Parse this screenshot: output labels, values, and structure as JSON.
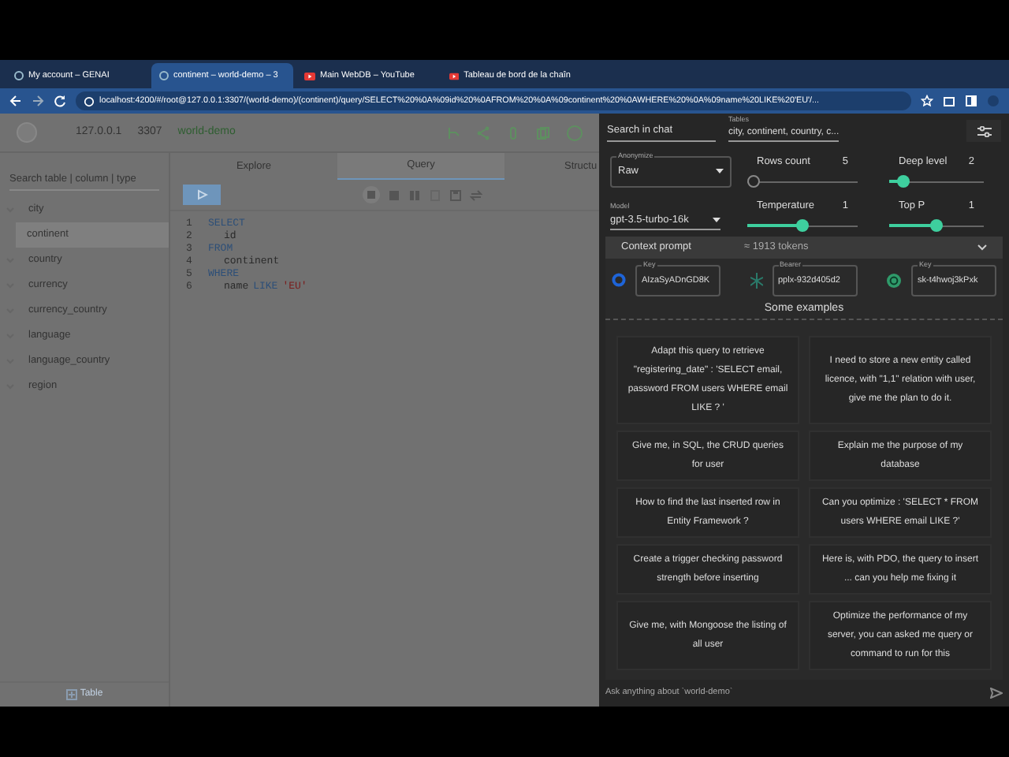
{
  "browser": {
    "tabs": [
      {
        "label": "My account – GENAI",
        "selected": false,
        "kind": "site"
      },
      {
        "label": "continent – world-demo – 3",
        "selected": true,
        "kind": "site"
      },
      {
        "label": "Main WebDB – YouTube",
        "selected": false,
        "kind": "video"
      },
      {
        "label": "Tableau de bord de la chaîn",
        "selected": false,
        "kind": "video"
      }
    ],
    "url": "localhost:4200/#/root@127.0.0.1:3307/(world-demo)/(continent)/query/SELECT%20%0A%09id%20%0AFROM%20%0A%09continent%20%0AWHERE%20%0A%09name%20LIKE%20'EU'/..."
  },
  "app": {
    "host": "127.0.0.1",
    "port": "3307",
    "database": "world-demo"
  },
  "sidebar": {
    "search": {
      "placeholder": "Search table | column | type"
    },
    "items": [
      {
        "label": "city",
        "selected": false
      },
      {
        "label": "continent",
        "selected": true
      },
      {
        "label": "country",
        "selected": false
      },
      {
        "label": "currency",
        "selected": false
      },
      {
        "label": "currency_country",
        "selected": false
      },
      {
        "label": "language",
        "selected": false
      },
      {
        "label": "language_country",
        "selected": false
      },
      {
        "label": "region",
        "selected": false
      }
    ],
    "add_button": "Table"
  },
  "main_tabs": [
    {
      "label": "Explore",
      "selected": false
    },
    {
      "label": "Query",
      "selected": true
    },
    {
      "label": "Structu",
      "selected": false
    }
  ],
  "editor": {
    "lines": [
      {
        "number": "1",
        "indented": false,
        "tokens": [
          {
            "text": "SELECT",
            "kind": "keyword"
          }
        ]
      },
      {
        "number": "2",
        "indented": true,
        "tokens": [
          {
            "text": "id",
            "kind": "ident"
          }
        ]
      },
      {
        "number": "3",
        "indented": false,
        "tokens": [
          {
            "text": "FROM",
            "kind": "keyword"
          }
        ]
      },
      {
        "number": "4",
        "indented": true,
        "tokens": [
          {
            "text": "continent",
            "kind": "ident"
          }
        ]
      },
      {
        "number": "5",
        "indented": false,
        "tokens": [
          {
            "text": "WHERE",
            "kind": "keyword"
          }
        ]
      },
      {
        "number": "6",
        "indented": true,
        "tokens": [
          {
            "text": "name",
            "kind": "ident"
          },
          {
            "text": "LIKE",
            "kind": "keyword"
          },
          {
            "text": "'EU'",
            "kind": "string"
          }
        ]
      }
    ]
  },
  "chat": {
    "search": {
      "placeholder": "Search in chat"
    },
    "tables": {
      "label": "Tables",
      "value": "city, continent, country, c..."
    },
    "anonymize": {
      "label": "Anonymize",
      "value": "Raw"
    },
    "model": {
      "label": "Model",
      "value": "gpt-3.5-turbo-16k"
    },
    "sliders": [
      {
        "label": "Rows count",
        "reading": "5",
        "level": 0
      },
      {
        "label": "Deep level",
        "reading": "2",
        "level": 0.15
      },
      {
        "label": "Temperature",
        "reading": "1",
        "level": 0.5
      },
      {
        "label": "Top P",
        "reading": "1",
        "level": 0.5
      }
    ],
    "context_prompt": {
      "label": "Context prompt",
      "tokens": "≈ 1913 tokens",
      "expanded": false
    },
    "keys": [
      {
        "kind": "google",
        "label": "Key",
        "value": "AIzaSyADnGD8K"
      },
      {
        "kind": "perplexity",
        "label": "Bearer",
        "value": "pplx-932d405d2"
      },
      {
        "kind": "openai",
        "label": "Key",
        "value": "sk-t4hwoj3kPxk"
      }
    ],
    "examples_title": "Some examples",
    "examples": [
      [
        "Adapt this query to retrieve \"registering_date\" : 'SELECT email, password FROM users WHERE email LIKE ? '",
        "I need to store a new entity called licence, with \"1,1\" relation with user, give me the plan to do it."
      ],
      [
        "Give me, in SQL, the CRUD queries for user",
        "Explain me the purpose of my database"
      ],
      [
        "How to find the last inserted row in Entity Framework ?",
        "Can you optimize : 'SELECT * FROM users WHERE email LIKE ?'"
      ],
      [
        "Create a trigger checking password strength before inserting",
        "Here is, with PDO, the query to insert ... can you help me fixing it"
      ],
      [
        "Give me, with Mongoose the listing of all user",
        "Optimize the performance of my server, you can asked me query or command to run for this"
      ]
    ],
    "input": {
      "placeholder": "Ask anything about `world-demo`"
    }
  }
}
